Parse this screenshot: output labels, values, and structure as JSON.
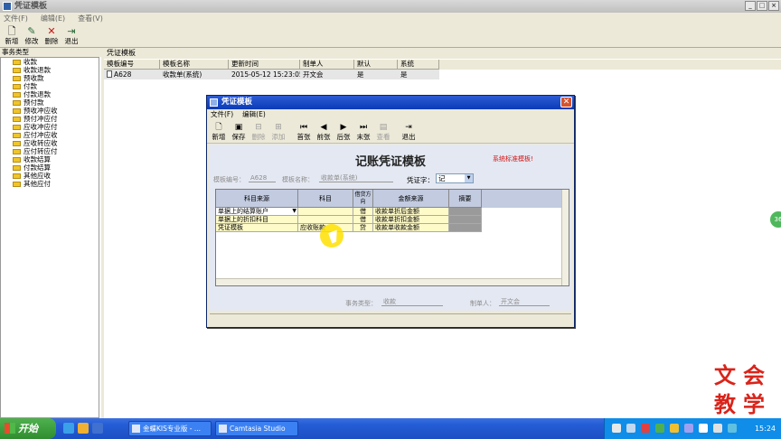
{
  "main_window": {
    "title": "凭证模板",
    "menu": [
      "文件(F)",
      "编辑(E)",
      "查看(V)"
    ],
    "toolbar": [
      "新增",
      "修改",
      "删除",
      "退出"
    ]
  },
  "tree": {
    "header": "事务类型",
    "items": [
      "收款",
      "收款退款",
      "预收款",
      "付款",
      "付款退款",
      "预付款",
      "预收冲应收",
      "预付冲应付",
      "应收冲应付",
      "应付冲应收",
      "应收转应收",
      "应付转应付",
      "收款结算",
      "付款结算",
      "其他应收",
      "其他应付"
    ]
  },
  "list": {
    "label": "凭证模板",
    "columns": [
      "模板编号",
      "模板名称",
      "更新时间",
      "制单人",
      "默认",
      "系统"
    ],
    "rows": [
      [
        "A628",
        "收款单(系统)",
        "2015-05-12 15:23:05",
        "开文会",
        "是",
        "是"
      ]
    ]
  },
  "dialog": {
    "title": "凭证模板",
    "menu": [
      "文件(F)",
      "编辑(E)"
    ],
    "toolbar": [
      {
        "label": "新增",
        "enabled": true,
        "icon": "new-icon"
      },
      {
        "label": "保存",
        "enabled": true,
        "icon": "save-icon"
      },
      {
        "label": "删除",
        "enabled": false,
        "icon": "delete-row-icon"
      },
      {
        "label": "添加",
        "enabled": false,
        "icon": "add-row-icon"
      },
      {
        "label": "首张",
        "enabled": true,
        "icon": "first-icon"
      },
      {
        "label": "前张",
        "enabled": true,
        "icon": "prev-icon"
      },
      {
        "label": "后张",
        "enabled": true,
        "icon": "next-icon"
      },
      {
        "label": "末张",
        "enabled": true,
        "icon": "last-icon"
      },
      {
        "label": "查看",
        "enabled": false,
        "icon": "view-icon"
      },
      {
        "label": "退出",
        "enabled": true,
        "icon": "exit-icon"
      }
    ],
    "voucher_title": "记账凭证模板",
    "standard_flag": "系统标准模板!",
    "template_no_label": "模板编号：",
    "template_no": "A628",
    "template_name_label": "模板名称：",
    "template_name": "收款单(系统)",
    "voucher_word_label": "凭证字：",
    "voucher_word": "记",
    "grid_columns": [
      "科目来源",
      "科目",
      "借贷方向",
      "金额来源",
      "摘要"
    ],
    "grid_rows": [
      [
        "单据上的结算账户",
        "",
        "借",
        "收款单折后金额",
        ""
      ],
      [
        "单据上的折扣科目",
        "",
        "借",
        "收款单折扣金额",
        ""
      ],
      [
        "凭证模板",
        "应收账款",
        "贷",
        "收款单收款金额",
        ""
      ]
    ],
    "business_type_label": "事务类型：",
    "business_type": "收款",
    "preparer_label": "制单人：",
    "preparer": "开文会"
  },
  "watermark": [
    "文",
    "会",
    "教",
    "学"
  ],
  "taskbar": {
    "start_label": "开始",
    "tasks": [
      "金蝶KIS专业版 - ...",
      "Camtasia Studio"
    ],
    "clock": "15:24"
  },
  "colors": {
    "dialog_title": "#0a3bb6",
    "grid_yellow": "#fffbc8",
    "grid_header": "#c2cbe0",
    "watermark": "#d9241a",
    "taskbar": "#245dd6",
    "start_button": "#2f8d2f"
  }
}
